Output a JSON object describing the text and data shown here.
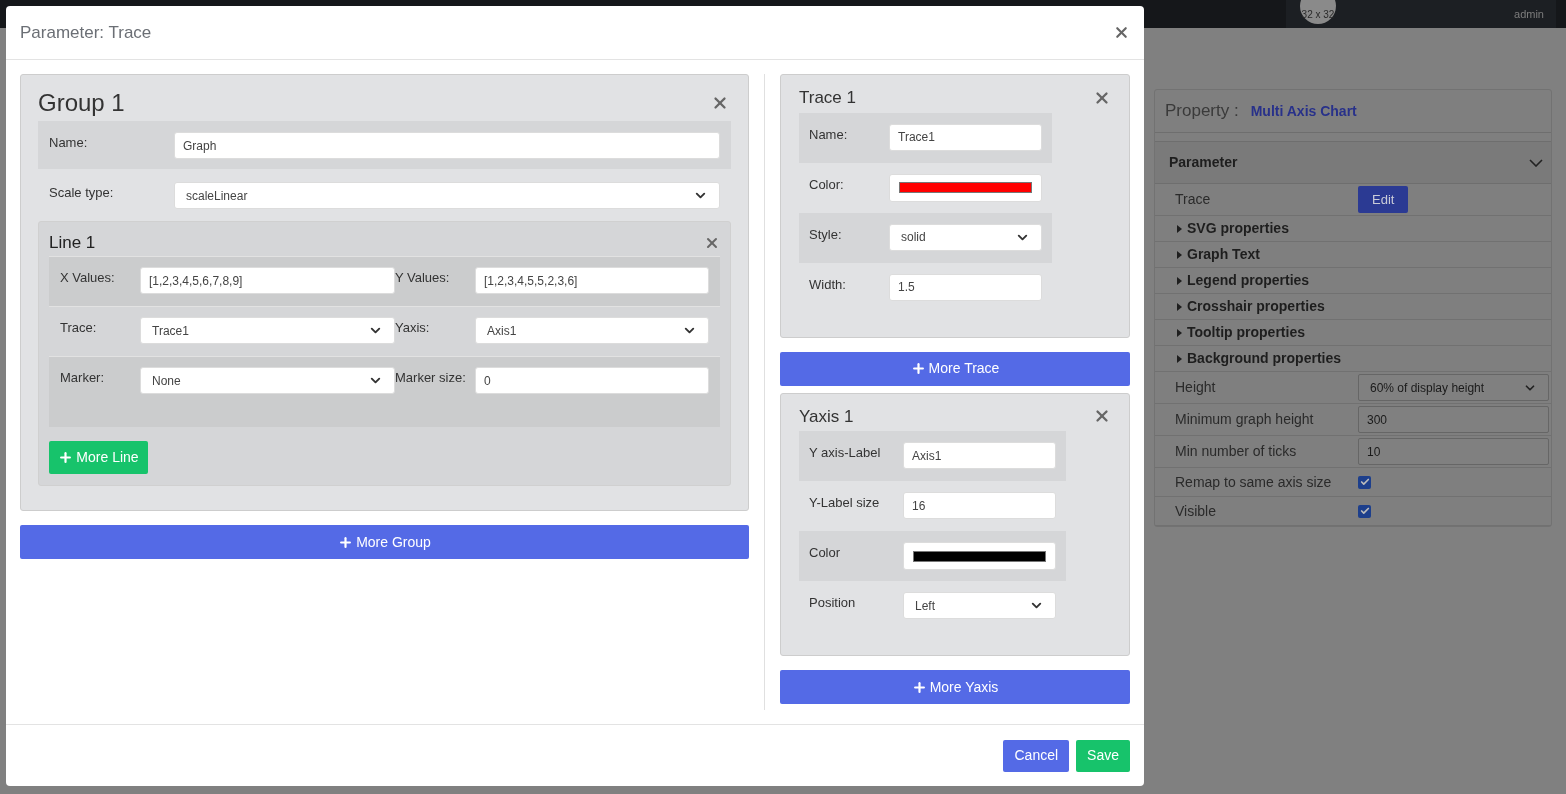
{
  "top_bar": {
    "avatar_text": "32 x 32",
    "user_role": "admin"
  },
  "property_panel": {
    "label": "Property :",
    "value": "Multi Axis Chart",
    "section": {
      "title": "Parameter",
      "expanded": true
    },
    "rows": [
      {
        "kind": "button",
        "label": "Trace",
        "value": "Edit"
      },
      {
        "kind": "group",
        "label": "SVG properties"
      },
      {
        "kind": "group",
        "label": "Graph Text"
      },
      {
        "kind": "group",
        "label": "Legend properties"
      },
      {
        "kind": "group",
        "label": "Crosshair properties"
      },
      {
        "kind": "group",
        "label": "Tooltip properties"
      },
      {
        "kind": "group",
        "label": "Background properties"
      },
      {
        "kind": "select",
        "label": "Height",
        "value": "60% of display height"
      },
      {
        "kind": "text",
        "label": "Minimum graph height",
        "value": "300"
      },
      {
        "kind": "text",
        "label": "Min number of ticks",
        "value": "10"
      },
      {
        "kind": "checkbox",
        "label": "Remap to same axis size",
        "checked": true
      },
      {
        "kind": "checkbox",
        "label": "Visible",
        "checked": true
      }
    ]
  },
  "modal": {
    "title": "Parameter: Trace",
    "groups": [
      {
        "title": "Group 1",
        "fields": [
          {
            "label": "Name:",
            "kind": "text",
            "value": "Graph"
          },
          {
            "label": "Scale type:",
            "kind": "select",
            "value": "scaleLinear"
          }
        ],
        "lines": [
          {
            "title": "Line 1",
            "rows": [
              [
                {
                  "label": "X Values:",
                  "kind": "text",
                  "value": "[1,2,3,4,5,6,7,8,9]"
                },
                {
                  "label": "Y Values:",
                  "kind": "text",
                  "value": "[1,2,3,4,5,5,2,3,6]"
                }
              ],
              [
                {
                  "label": "Trace:",
                  "kind": "select",
                  "value": "Trace1"
                },
                {
                  "label": "Yaxis:",
                  "kind": "select",
                  "value": "Axis1"
                }
              ],
              [
                {
                  "label": "Marker:",
                  "kind": "select",
                  "value": "None"
                },
                {
                  "label": "Marker size:",
                  "kind": "text",
                  "value": "0"
                }
              ]
            ]
          }
        ],
        "add_line": "More Line"
      }
    ],
    "add_group": "More Group",
    "traces": [
      {
        "title": "Trace 1",
        "fields": [
          {
            "label": "Name:",
            "kind": "text",
            "value": "Trace1"
          },
          {
            "label": "Color:",
            "kind": "color",
            "color": "#ff0000"
          },
          {
            "label": "Style:",
            "kind": "select",
            "value": "solid"
          },
          {
            "label": "Width:",
            "kind": "text",
            "value": "1.5"
          }
        ]
      }
    ],
    "add_trace": "More Trace",
    "yaxes": [
      {
        "title": "Yaxis 1",
        "fields": [
          {
            "label": "Y axis-Label",
            "kind": "text",
            "value": "Axis1"
          },
          {
            "label": "Y-Label size",
            "kind": "text",
            "value": "16"
          },
          {
            "label": "Color",
            "kind": "color",
            "color": "#000000"
          },
          {
            "label": "Position",
            "kind": "select",
            "value": "Left"
          }
        ]
      }
    ],
    "add_yaxis": "More Yaxis",
    "buttons": [
      {
        "label": "Cancel",
        "kind": "secondary"
      },
      {
        "label": "Save",
        "kind": "primary"
      }
    ]
  }
}
